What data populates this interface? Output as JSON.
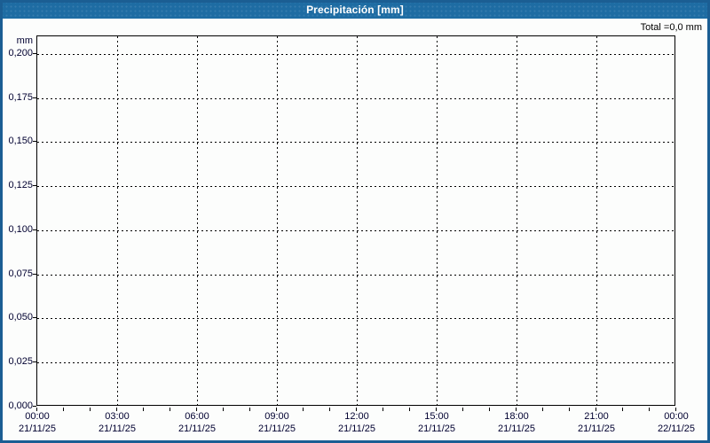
{
  "header": {
    "title": "Precipitación [mm]"
  },
  "summary": {
    "total_label": "Total =0,0 mm"
  },
  "colors": {
    "header_bg": "#1e6ca3",
    "frame_border": "#1b5e93",
    "background": "#fcfdfc",
    "axis": "#000000",
    "grid": "#000000",
    "tick_text": "#000030",
    "title_text": "#ffffff"
  },
  "chart_data": {
    "type": "bar",
    "title": "Precipitación [mm]",
    "ylabel": "mm",
    "xlabel": "",
    "ylim": [
      0,
      0.21
    ],
    "ytick_step": 0.025,
    "grid": true,
    "grid_style": "dashed",
    "yticks": [
      {
        "value": 0.2,
        "label": "0,200"
      },
      {
        "value": 0.175,
        "label": "0,175"
      },
      {
        "value": 0.15,
        "label": "0,150"
      },
      {
        "value": 0.125,
        "label": "0,125"
      },
      {
        "value": 0.1,
        "label": "0,100"
      },
      {
        "value": 0.075,
        "label": "0,075"
      },
      {
        "value": 0.05,
        "label": "0,050"
      },
      {
        "value": 0.025,
        "label": "0,025"
      },
      {
        "value": 0.0,
        "label": "0,000"
      }
    ],
    "xticks": [
      {
        "time": "00:00",
        "date": "21/11/25"
      },
      {
        "time": "03:00",
        "date": "21/11/25"
      },
      {
        "time": "06:00",
        "date": "21/11/25"
      },
      {
        "time": "09:00",
        "date": "21/11/25"
      },
      {
        "time": "12:00",
        "date": "21/11/25"
      },
      {
        "time": "15:00",
        "date": "21/11/25"
      },
      {
        "time": "18:00",
        "date": "21/11/25"
      },
      {
        "time": "21:00",
        "date": "21/11/25"
      },
      {
        "time": "00:00",
        "date": "22/11/25"
      }
    ],
    "x_range_hours": 24,
    "x_major_interval_hours": 3,
    "x_minor_tick_interval_hours": 1,
    "series": [
      {
        "name": "Precipitación",
        "values": []
      }
    ],
    "total_mm": "0,0"
  }
}
